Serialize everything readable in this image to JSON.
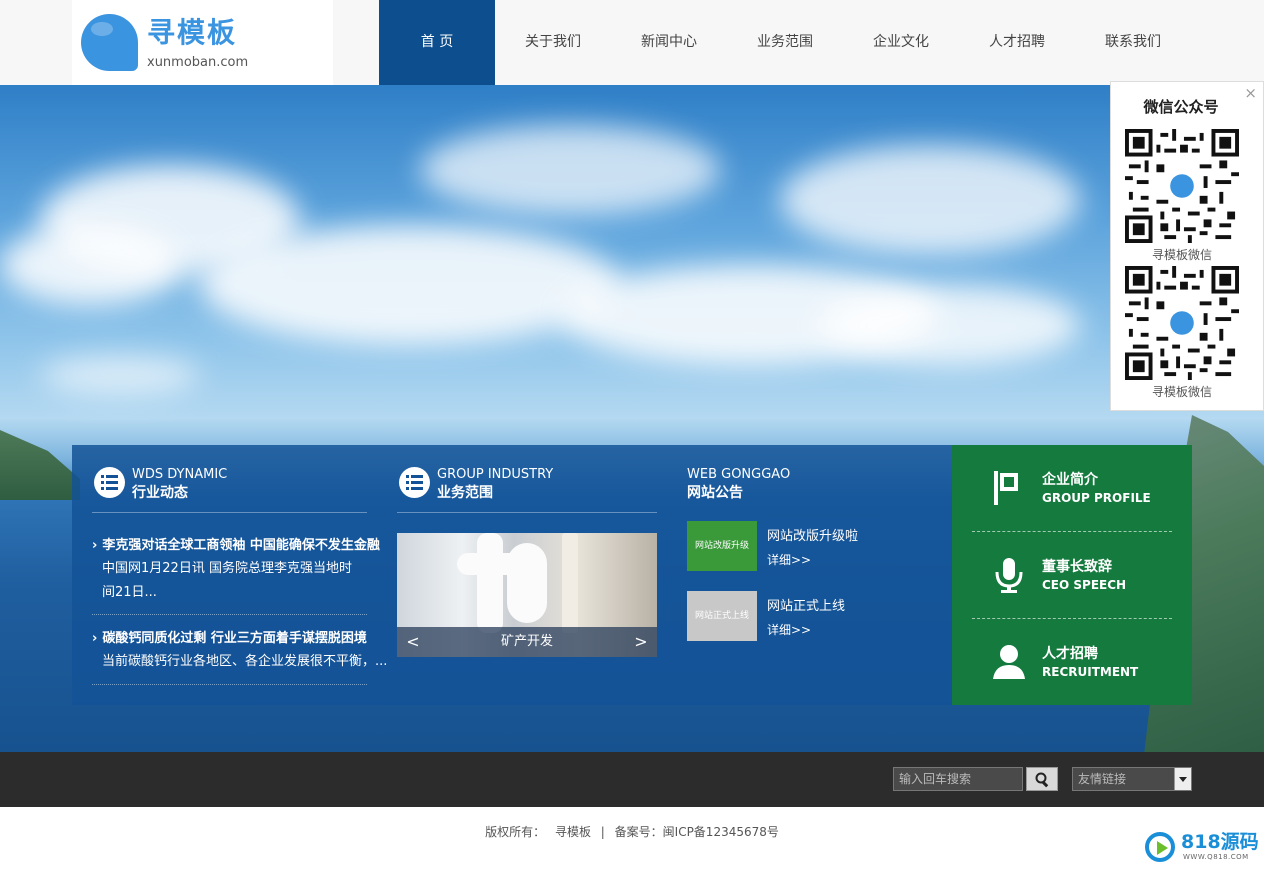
{
  "header": {
    "logo_cn": "寻模板",
    "logo_en": "xunmoban.com",
    "nav": [
      {
        "label": "首 页",
        "active": true
      },
      {
        "label": "关于我们",
        "active": false
      },
      {
        "label": "新闻中心",
        "active": false
      },
      {
        "label": "业务范围",
        "active": false
      },
      {
        "label": "企业文化",
        "active": false
      },
      {
        "label": "人才招聘",
        "active": false
      },
      {
        "label": "联系我们",
        "active": false
      }
    ]
  },
  "wechat": {
    "title": "微信公众号",
    "close": "×",
    "qr_codes": [
      {
        "label": "寻模板微信"
      },
      {
        "label": "寻模板微信"
      }
    ]
  },
  "dynamic": {
    "en": "WDS DYNAMIC",
    "cn": "行业动态",
    "news": [
      {
        "title": "李克强对话全球工商领袖 中国能确保不发生金融",
        "desc": "中国网1月22日讯 国务院总理李克强当地时间21日..."
      },
      {
        "title": "碳酸钙同质化过剩 行业三方面着手谋摆脱困境",
        "desc": "当前碳酸钙行业各地区、各企业发展很不平衡，..."
      }
    ]
  },
  "industry": {
    "en": "GROUP INDUSTRY",
    "cn": "业务范围",
    "slide_caption": "矿产开发",
    "prev": "<",
    "next": ">"
  },
  "notice": {
    "en": "WEB GONGGAO",
    "cn": "网站公告",
    "items": [
      {
        "thumb": "网站改版升级",
        "thumb_color": "#3a9a3a",
        "title": "网站改版升级啦",
        "more": "详细>>"
      },
      {
        "thumb": "网站正式上线",
        "thumb_color": "#c8c8c8",
        "title": "网站正式上线",
        "more": "详细>>"
      }
    ]
  },
  "sidebar_links": [
    {
      "cn": "企业简介",
      "en": "GROUP PROFILE",
      "icon": "flag-icon"
    },
    {
      "cn": "董事长致辞",
      "en": "CEO SPEECH",
      "icon": "microphone-icon"
    },
    {
      "cn": "人才招聘",
      "en": "RECRUITMENT",
      "icon": "person-icon"
    }
  ],
  "footer": {
    "search_placeholder": "输入回车搜索",
    "links_select": "友情链接",
    "copyright_label": "版权所有：",
    "copyright_owner": "寻模板",
    "separator": "|",
    "icp": "备案号：闽ICP备12345678号"
  },
  "badge": {
    "text": "818源码",
    "sub": "WWW.Q818.COM"
  },
  "colors": {
    "nav_active": "#0d4e8e",
    "brand_blue": "#3b94e0",
    "panel_blue": "#135296",
    "green": "#157a3e",
    "footer_dark": "#2c2c2c"
  }
}
